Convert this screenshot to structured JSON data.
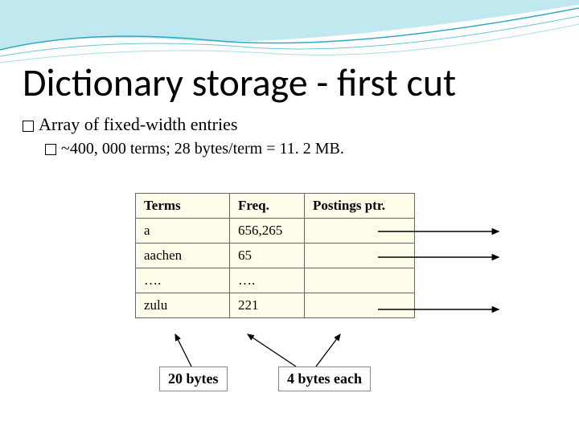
{
  "title": "Dictionary storage - first cut",
  "bullets": {
    "b1": "Array of fixed-width entries",
    "b2": "~400, 000 terms; 28 bytes/term = 11. 2 MB."
  },
  "table": {
    "head": {
      "terms": "Terms",
      "freq": "Freq.",
      "ptr": "Postings ptr."
    },
    "rows": [
      {
        "term": "a",
        "freq": "656,265"
      },
      {
        "term": "aachen",
        "freq": "65"
      },
      {
        "term": "….",
        "freq": "…."
      },
      {
        "term": "zulu",
        "freq": "221"
      }
    ]
  },
  "labels": {
    "bytes20": "20 bytes",
    "bytes4each": "4 bytes each"
  }
}
